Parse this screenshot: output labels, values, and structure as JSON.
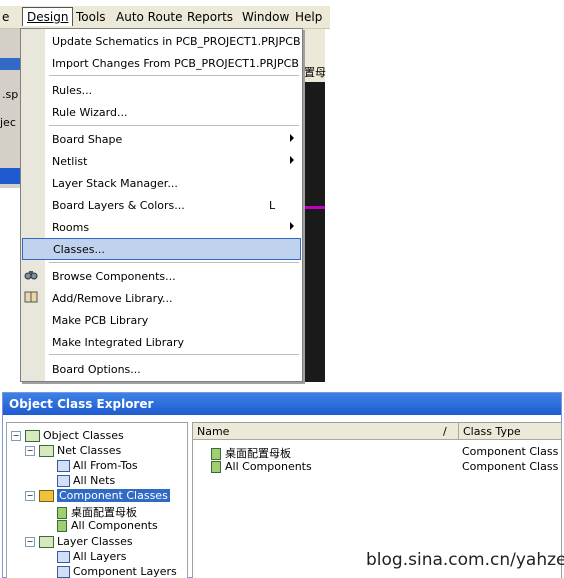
{
  "menubar": {
    "partial_left": "e",
    "items": [
      {
        "label": "Design"
      },
      {
        "label": "Tools"
      },
      {
        "label": "Auto Route"
      },
      {
        "label": "Reports"
      },
      {
        "label": "Window"
      },
      {
        "label": "Help"
      }
    ]
  },
  "background": {
    "frag_sp": ".sp",
    "frag_jec": "jec",
    "frag_chinese": "置母"
  },
  "design_menu": {
    "items": [
      {
        "label": "Update Schematics in PCB_PROJECT1.PRJPCB",
        "icon": ""
      },
      {
        "label": "Import Changes From PCB_PROJECT1.PRJPCB",
        "icon": ""
      },
      {
        "label": "Rules...",
        "icon": ""
      },
      {
        "label": "Rule Wizard...",
        "icon": ""
      },
      {
        "label": "Board Shape",
        "submenu": true
      },
      {
        "label": "Netlist",
        "submenu": true
      },
      {
        "label": "Layer Stack Manager...",
        "icon": ""
      },
      {
        "label": "Board Layers & Colors...",
        "shortcut": "L"
      },
      {
        "label": "Rooms",
        "submenu": true
      },
      {
        "label": "Classes...",
        "highlighted": true
      },
      {
        "label": "Browse Components...",
        "icon": "binoculars-icon"
      },
      {
        "label": "Add/Remove Library...",
        "icon": "book-icon"
      },
      {
        "label": "Make PCB Library"
      },
      {
        "label": "Make Integrated Library"
      },
      {
        "label": "Board Options..."
      }
    ]
  },
  "explorer": {
    "title": "Object Class Explorer",
    "tree": {
      "root": "Object Classes",
      "net_classes": "Net Classes",
      "all_from_tos": "All From-Tos",
      "all_nets": "All Nets",
      "component_classes": "Component Classes",
      "comp_chinese": "桌面配置母板",
      "all_components": "All Components",
      "layer_classes": "Layer Classes",
      "all_layers": "All Layers",
      "component_layers": "Component Layers"
    },
    "columns": {
      "name": "Name",
      "class_type": "Class Type"
    },
    "rows": [
      {
        "name": "桌面配置母板",
        "type": "Component Class"
      },
      {
        "name": "All Components",
        "type": "Component Class"
      }
    ]
  },
  "watermark": "blog.sina.com.cn/yahzee",
  "colors": {
    "menu_highlight": "#c1d2ee",
    "titlebar": "#1f5bd0",
    "tree_selection": "#316ac5"
  }
}
